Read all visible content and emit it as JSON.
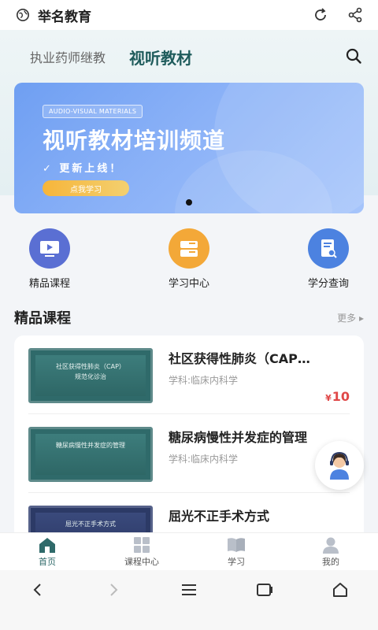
{
  "browser": {
    "title": "举名教育"
  },
  "tabs": [
    {
      "label": "执业药师继教"
    },
    {
      "label": "视听教材"
    }
  ],
  "banner": {
    "badge": "AUDIO-VISUAL MATERIALS",
    "headline": "视听教材培训频道",
    "subline": "✓ 更新上线！",
    "cta": "点我学习"
  },
  "quick_entries": [
    {
      "label": "精品课程",
      "icon": "play-screen-icon",
      "color": "#5a6fd3"
    },
    {
      "label": "学习中心",
      "icon": "books-icon",
      "color": "#f3a838"
    },
    {
      "label": "学分查询",
      "icon": "document-search-icon",
      "color": "#4c82e0"
    }
  ],
  "section": {
    "title": "精品课程",
    "more": "更多 ▸"
  },
  "courses": [
    {
      "thumb_text": "社区获得性肺炎（CAP）\n规范化诊治",
      "title": "社区获得性肺炎（CAP…",
      "subject": "学科:临床内科学",
      "price_symbol": "¥",
      "price": "10"
    },
    {
      "thumb_text": "糖尿病慢性并发症的管理",
      "title": "糖尿病慢性并发症的管理",
      "subject": "学科:临床内科学",
      "price_symbol": "¥",
      "price": "10"
    },
    {
      "thumb_text": "屈光不正手术方式",
      "title": "屈光不正手术方式",
      "subject": "",
      "price_symbol": "",
      "price": ""
    }
  ],
  "bottom_nav": [
    {
      "label": "首页",
      "icon": "home-icon",
      "active": true
    },
    {
      "label": "课程中心",
      "icon": "grid-icon",
      "active": false
    },
    {
      "label": "学习",
      "icon": "book-icon",
      "active": false
    },
    {
      "label": "我的",
      "icon": "user-icon",
      "active": false
    }
  ],
  "colors": {
    "accent": "#2f6a6a",
    "price": "#e04848",
    "banner": "#6f9ff2"
  }
}
